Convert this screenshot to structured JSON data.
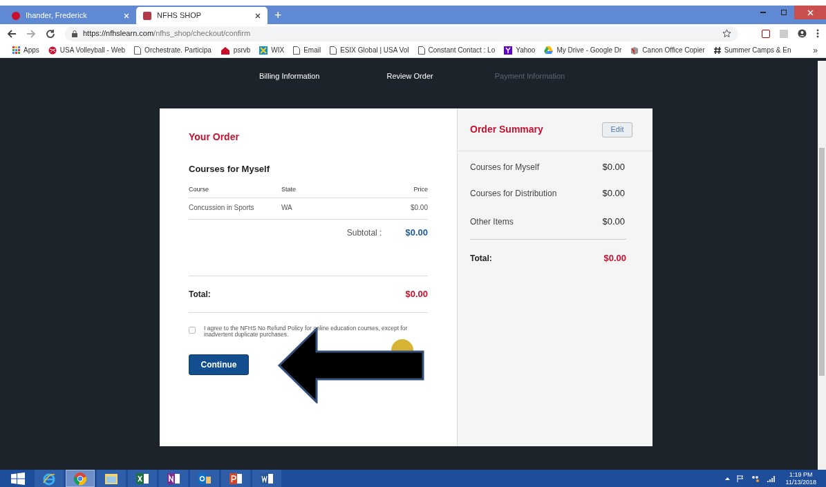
{
  "browser": {
    "tabs": [
      {
        "title": "Ihander, Frederick",
        "selected": false
      },
      {
        "title": "NFHS SHOP",
        "selected": true
      }
    ],
    "new_tab": "+",
    "url": {
      "host": "https://nfhslearn.com",
      "path": "/nfhs_shop/checkout/confirm"
    },
    "bookmarks": [
      {
        "label": "Apps",
        "kind": "apps"
      },
      {
        "label": "USA Volleyball - Web",
        "kind": "ball"
      },
      {
        "label": "Orchestrate. Participa",
        "kind": "page"
      },
      {
        "label": "psrvb",
        "kind": "house"
      },
      {
        "label": "WIX",
        "kind": "wix"
      },
      {
        "label": "Email",
        "kind": "page"
      },
      {
        "label": "ESIX Global | USA Vol",
        "kind": "page"
      },
      {
        "label": "Constant Contact : Lo",
        "kind": "page"
      },
      {
        "label": "Yahoo",
        "kind": "yahoo"
      },
      {
        "label": "My Drive - Google Dr",
        "kind": "drive"
      },
      {
        "label": "Canon Office Copier",
        "kind": "box"
      },
      {
        "label": "Summer Camps & En",
        "kind": "hash"
      }
    ],
    "more": "»"
  },
  "steps": [
    {
      "label": "Billing Information",
      "enabled": true
    },
    {
      "label": "Review Order",
      "enabled": true
    },
    {
      "label": "Payment Information",
      "enabled": false
    }
  ],
  "order": {
    "title": "Your Order",
    "section": "Courses for Myself",
    "columns": [
      "Course",
      "State",
      "Price"
    ],
    "rows": [
      [
        "Concussion in Sports",
        "WA",
        "$0.00"
      ]
    ],
    "subtotal_label": "Subtotal :",
    "subtotal": "$0.00",
    "total_label": "Total:",
    "total": "$0.00",
    "agree": {
      "label": "I agree to the NFHS No Refund Policy for online education courses, except for inadvertent duplicate purchases.",
      "checked": false
    },
    "button": "Continue"
  },
  "summary": {
    "title": "Order Summary",
    "edit": "Edit",
    "lines": [
      {
        "label": "Courses for Myself",
        "value": "$0.00"
      },
      {
        "label": "Courses for Distribution",
        "value": "$0.00"
      },
      {
        "label": "Other Items",
        "value": "$0.00"
      }
    ],
    "total_label": "Total:",
    "total": "$0.00"
  },
  "taskbar": {
    "apps": [
      {
        "kind": "ie",
        "selected": false
      },
      {
        "kind": "chrome",
        "selected": true
      },
      {
        "kind": "files",
        "selected": false
      },
      {
        "kind": "excel",
        "selected": false
      },
      {
        "kind": "onenote",
        "selected": false
      },
      {
        "kind": "outlook",
        "selected": false
      },
      {
        "kind": "powerpoint",
        "selected": false
      },
      {
        "kind": "word",
        "selected": false
      }
    ],
    "time": "1:19 PM",
    "date": "11/13/2018"
  }
}
